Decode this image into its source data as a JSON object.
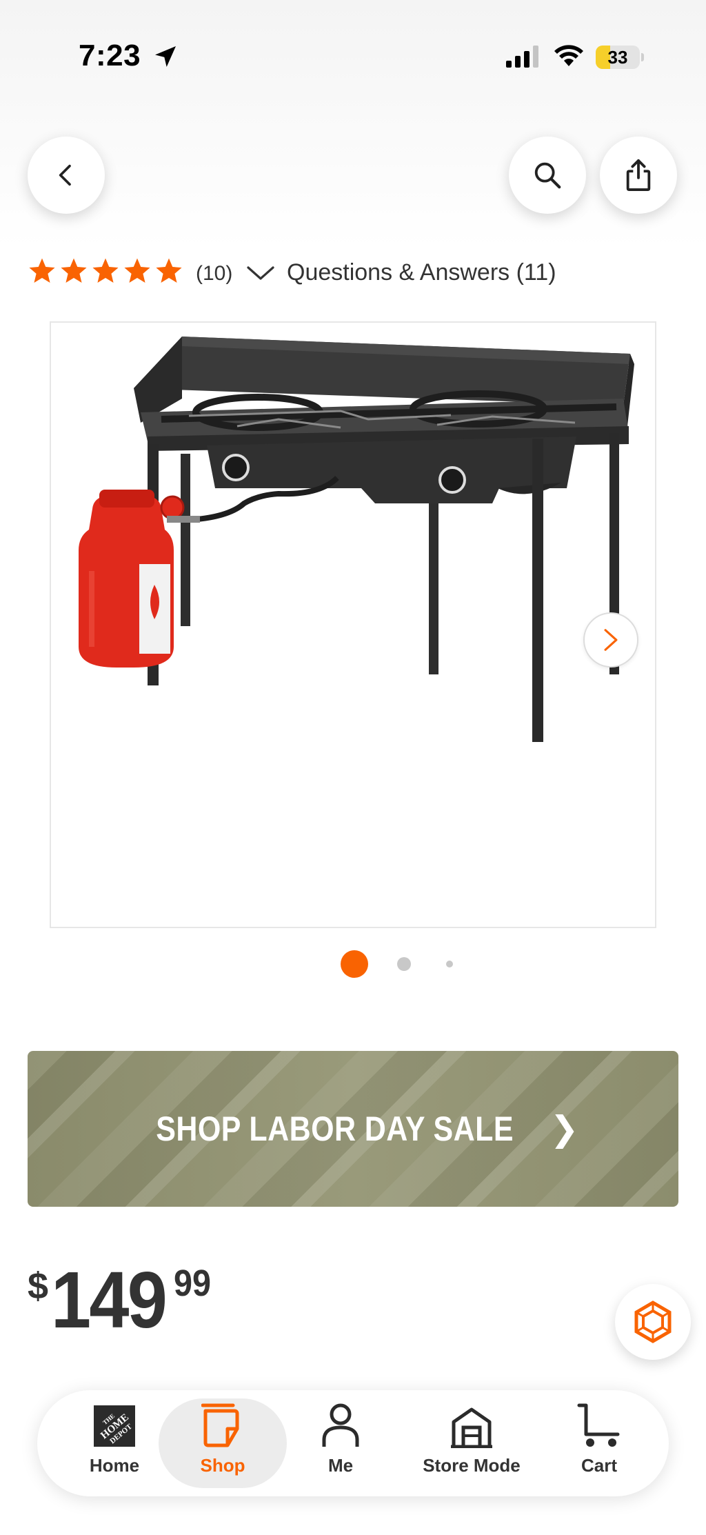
{
  "status_bar": {
    "time": "7:23",
    "battery": "33",
    "battery_level": 0.33
  },
  "header": {
    "back_icon": "chevron-left-icon",
    "search_icon": "search-icon",
    "share_icon": "share-icon"
  },
  "rating": {
    "stars": 5,
    "count": "(10)",
    "qa_label": "Questions & Answers (11)"
  },
  "gallery": {
    "image_description_icon": "camp-stove-image",
    "current_index": 1,
    "total": 3
  },
  "promo": {
    "label": "SHOP LABOR DAY SALE",
    "chevron": "❯"
  },
  "price": {
    "symbol": "$",
    "dollars": "149",
    "cents": "99"
  },
  "bottom_nav": {
    "items": [
      {
        "label": "Home",
        "icon": "home-depot-logo-icon"
      },
      {
        "label": "Shop",
        "icon": "shop-bag-icon"
      },
      {
        "label": "Me",
        "icon": "person-icon"
      },
      {
        "label": "Store Mode",
        "icon": "store-icon"
      },
      {
        "label": "Cart",
        "icon": "cart-icon"
      }
    ],
    "active": "Shop"
  },
  "colors": {
    "accent": "#f96302",
    "text": "#333333",
    "banner": "#929374"
  }
}
